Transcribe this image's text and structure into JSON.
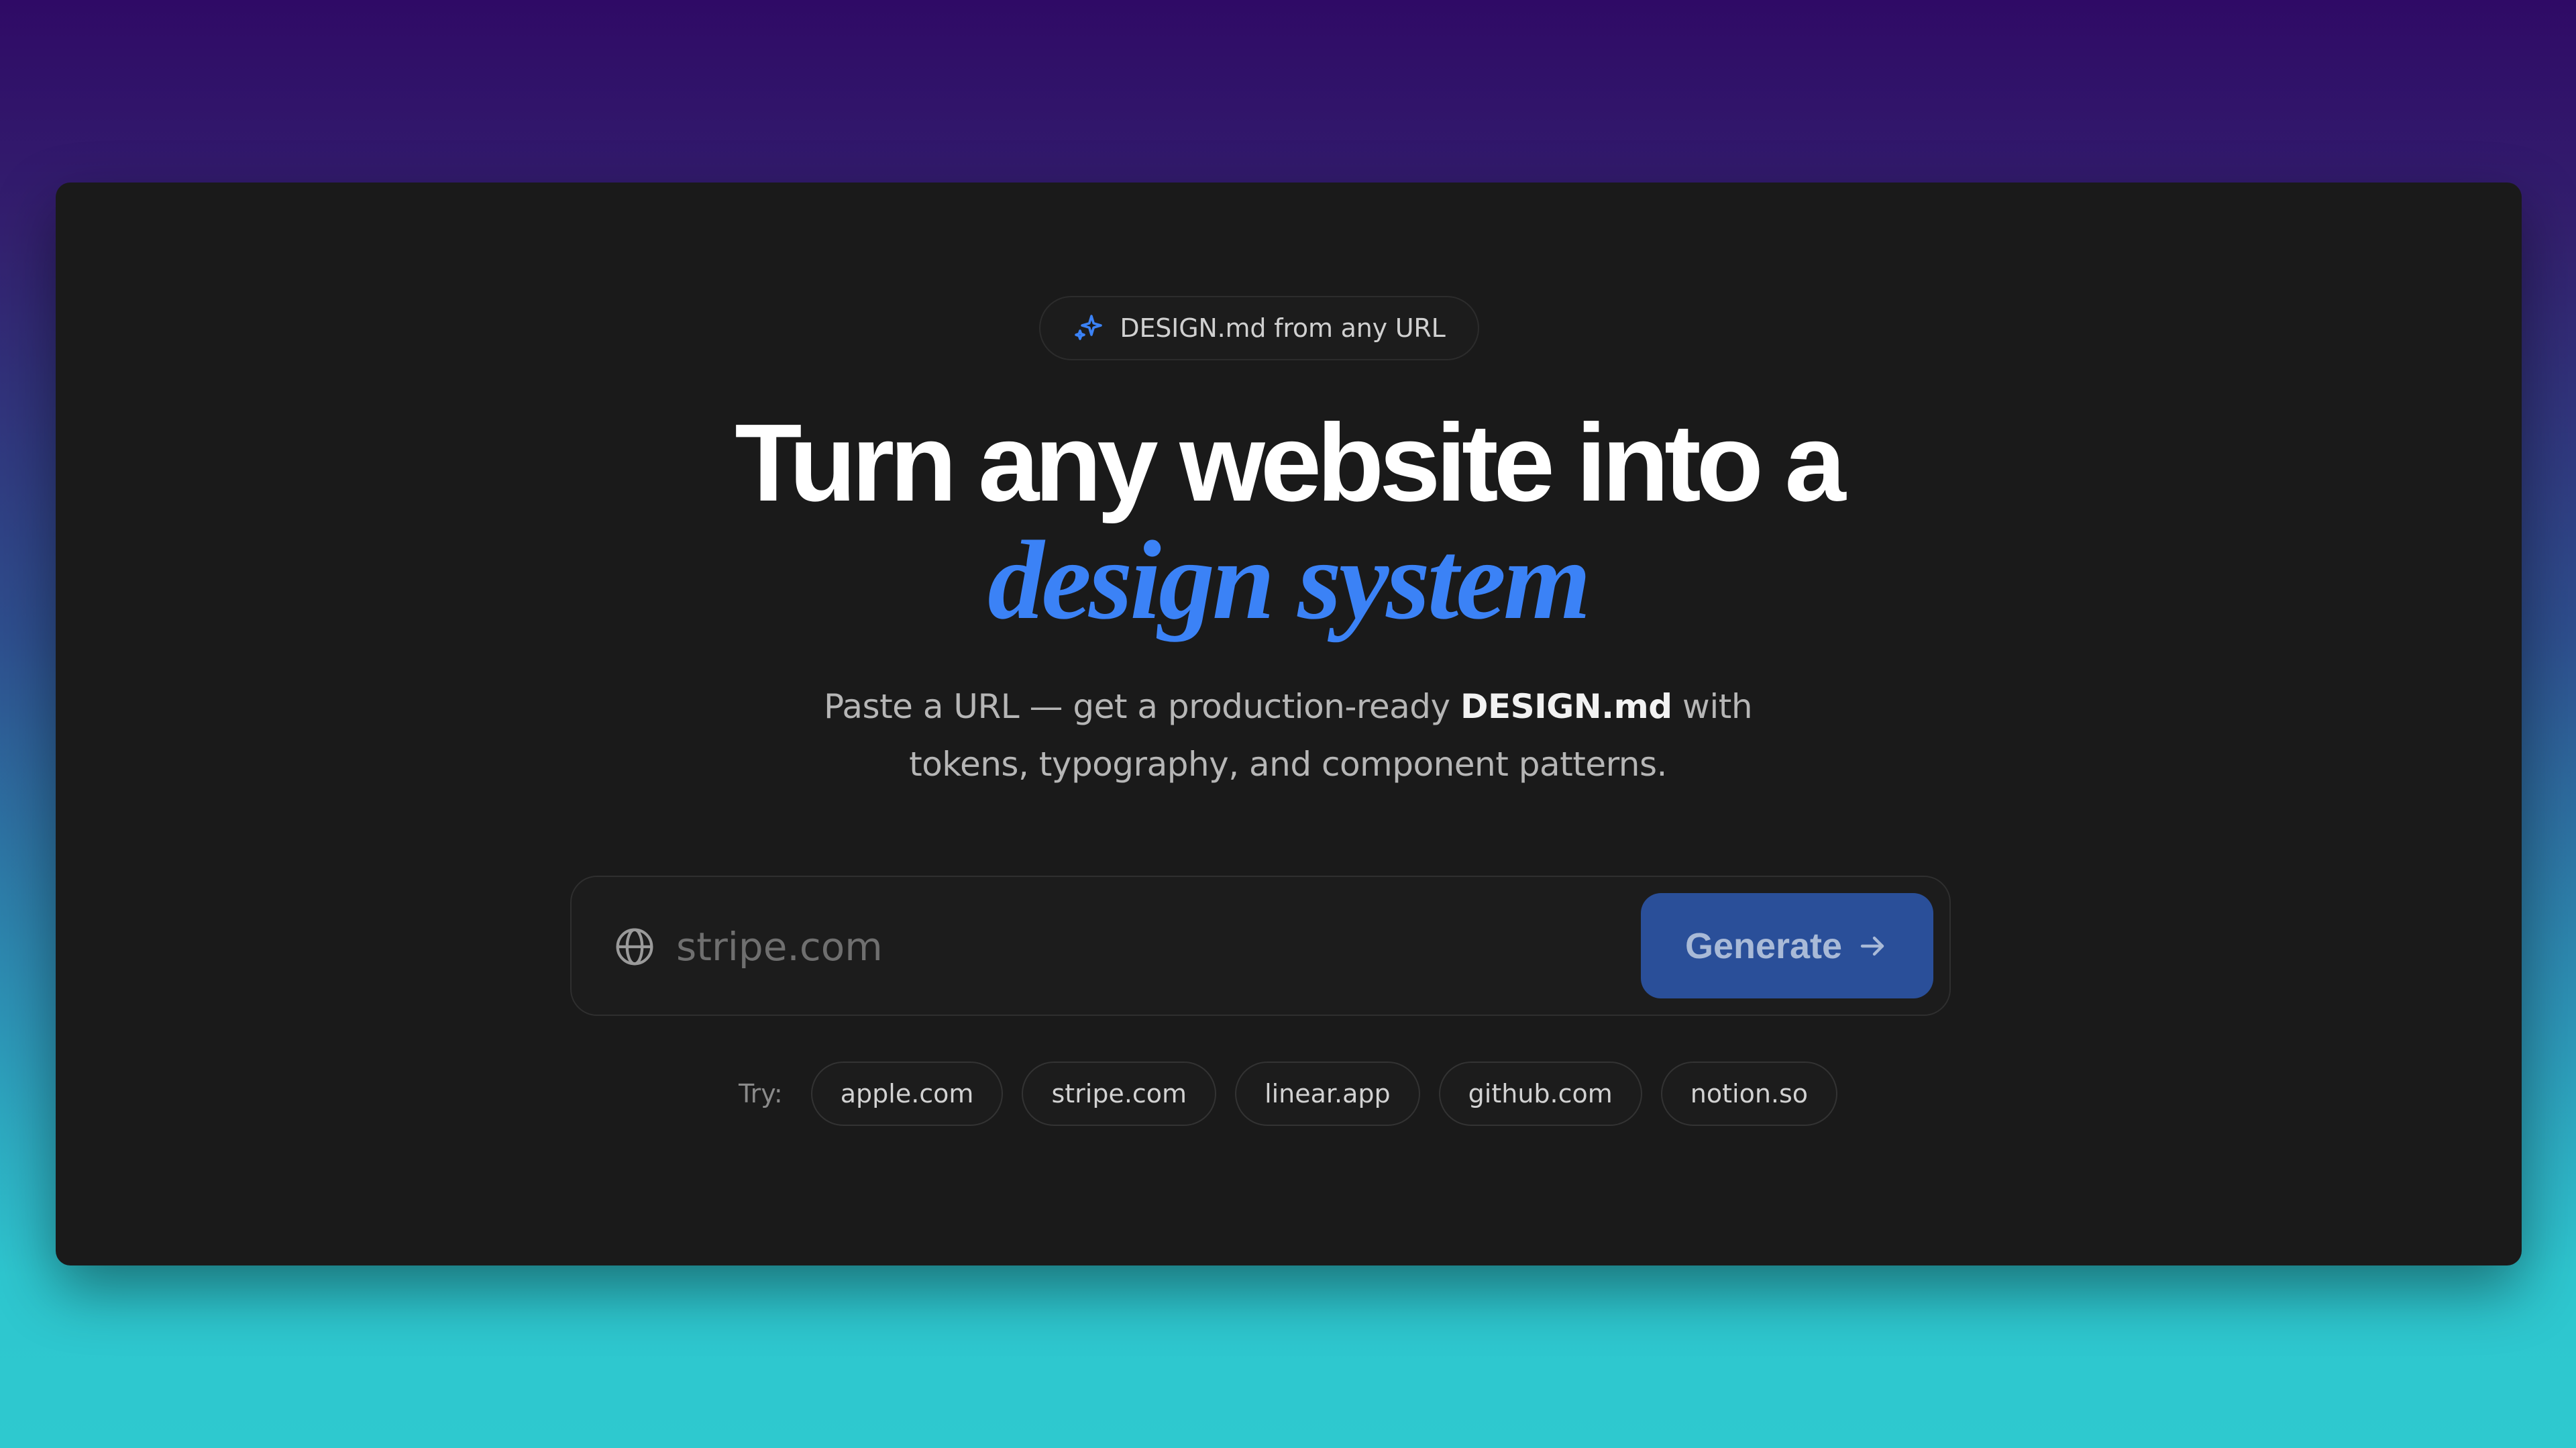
{
  "badge": {
    "icon": "sparkles-icon",
    "label": "DESIGN.md from any URL",
    "icon_color": "#3b82f6"
  },
  "hero": {
    "headline": "Turn any website into a",
    "accent": "design system",
    "accent_color": "#3b82f6",
    "subtitle_before": "Paste a URL — get a production-ready ",
    "subtitle_highlight": "DESIGN.md",
    "subtitle_after_line1": " with",
    "subtitle_line2": "tokens, typography, and component patterns."
  },
  "search": {
    "icon": "globe-icon",
    "placeholder": "stripe.com",
    "value": "",
    "button_label": "Generate",
    "button_icon": "arrow-right-icon",
    "button_color": "#2a4f99"
  },
  "suggestions": {
    "label": "Try:",
    "items": [
      "apple.com",
      "stripe.com",
      "linear.app",
      "github.com",
      "notion.so"
    ]
  }
}
